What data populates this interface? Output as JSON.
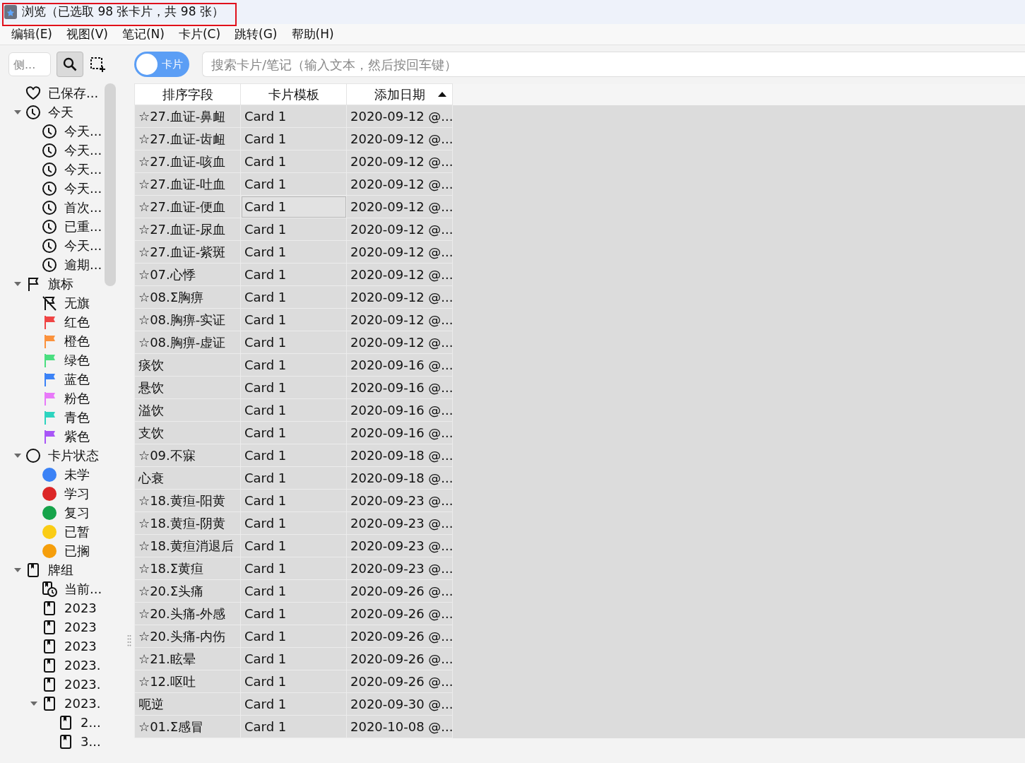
{
  "window": {
    "title": "浏览（已选取 98 张卡片，共 98 张）",
    "highlighted": true
  },
  "menu": [
    "编辑(E)",
    "视图(V)",
    "笔记(N)",
    "卡片(C)",
    "跳转(G)",
    "帮助(H)"
  ],
  "sidebar": {
    "search": {
      "placeholder": "侧..."
    },
    "items": [
      {
        "kind": "heart",
        "label": "已保存..."
      },
      {
        "kind": "clock",
        "label": "今天",
        "expanded": true,
        "children": [
          {
            "kind": "clock",
            "label": "今天..."
          },
          {
            "kind": "clock",
            "label": "今天..."
          },
          {
            "kind": "clock",
            "label": "今天..."
          },
          {
            "kind": "clock",
            "label": "今天..."
          },
          {
            "kind": "clock",
            "label": "首次..."
          },
          {
            "kind": "clock",
            "label": "已重..."
          },
          {
            "kind": "clock",
            "label": "今天..."
          },
          {
            "kind": "clock",
            "label": "逾期..."
          }
        ]
      },
      {
        "kind": "flag",
        "label": "旗标",
        "expanded": true,
        "children": [
          {
            "kind": "flag-off",
            "label": "无旗"
          },
          {
            "kind": "flag",
            "label": "红色",
            "color": "#ef4444"
          },
          {
            "kind": "flag",
            "label": "橙色",
            "color": "#fb923c"
          },
          {
            "kind": "flag",
            "label": "绿色",
            "color": "#4ade80"
          },
          {
            "kind": "flag",
            "label": "蓝色",
            "color": "#3b82f6"
          },
          {
            "kind": "flag",
            "label": "粉色",
            "color": "#e879f9"
          },
          {
            "kind": "flag",
            "label": "青色",
            "color": "#2dd4bf"
          },
          {
            "kind": "flag",
            "label": "紫色",
            "color": "#a855f7"
          }
        ]
      },
      {
        "kind": "circle",
        "label": "卡片状态",
        "expanded": true,
        "children": [
          {
            "kind": "dot",
            "label": "未学",
            "color": "#3b82f6"
          },
          {
            "kind": "dot",
            "label": "学习",
            "color": "#dc2626"
          },
          {
            "kind": "dot",
            "label": "复习",
            "color": "#16a34a"
          },
          {
            "kind": "dot",
            "label": "已暂",
            "color": "#facc15"
          },
          {
            "kind": "dot",
            "label": "已搁",
            "color": "#f59e0b"
          }
        ]
      },
      {
        "kind": "deck",
        "label": "牌组",
        "expanded": true,
        "children": [
          {
            "kind": "deck-clock",
            "label": "当前..."
          },
          {
            "kind": "deck",
            "label": "2023"
          },
          {
            "kind": "deck",
            "label": "2023"
          },
          {
            "kind": "deck",
            "label": "2023"
          },
          {
            "kind": "deck",
            "label": "2023."
          },
          {
            "kind": "deck",
            "label": "2023."
          },
          {
            "kind": "deck",
            "label": "2023.",
            "expanded": true,
            "children": [
              {
                "kind": "deck",
                "label": "2..."
              },
              {
                "kind": "deck",
                "label": "3..."
              }
            ]
          }
        ]
      }
    ]
  },
  "toolbar": {
    "toggle": {
      "label": "卡片",
      "on": false
    },
    "search": {
      "placeholder": "搜索卡片/笔记（输入文本，然后按回车键）"
    }
  },
  "table": {
    "columns": [
      {
        "label": "排序字段",
        "sorted": false
      },
      {
        "label": "卡片模板",
        "sorted": false
      },
      {
        "label": "添加日期",
        "sorted": true
      }
    ],
    "rows": [
      {
        "cells": [
          "☆27.血证-鼻衄",
          "Card 1",
          "2020-09-12 @..."
        ],
        "focused": false
      },
      {
        "cells": [
          "☆27.血证-齿衄",
          "Card 1",
          "2020-09-12 @..."
        ],
        "focused": false
      },
      {
        "cells": [
          "☆27.血证-咳血",
          "Card 1",
          "2020-09-12 @..."
        ],
        "focused": false
      },
      {
        "cells": [
          "☆27.血证-吐血",
          "Card 1",
          "2020-09-12 @..."
        ],
        "focused": false
      },
      {
        "cells": [
          "☆27.血证-便血",
          "Card 1",
          "2020-09-12 @..."
        ],
        "focused": true
      },
      {
        "cells": [
          "☆27.血证-尿血",
          "Card 1",
          "2020-09-12 @..."
        ],
        "focused": false
      },
      {
        "cells": [
          "☆27.血证-紫斑",
          "Card 1",
          "2020-09-12 @..."
        ],
        "focused": false
      },
      {
        "cells": [
          "☆07.心悸",
          "Card 1",
          "2020-09-12 @..."
        ],
        "focused": false
      },
      {
        "cells": [
          "☆08.Σ胸痹",
          "Card 1",
          "2020-09-12 @..."
        ],
        "focused": false
      },
      {
        "cells": [
          "☆08.胸痹-实证",
          "Card 1",
          "2020-09-12 @..."
        ],
        "focused": false
      },
      {
        "cells": [
          "☆08.胸痹-虚证",
          "Card 1",
          "2020-09-12 @..."
        ],
        "focused": false
      },
      {
        "cells": [
          "痰饮",
          "Card 1",
          "2020-09-16 @..."
        ],
        "focused": false
      },
      {
        "cells": [
          "悬饮",
          "Card 1",
          "2020-09-16 @..."
        ],
        "focused": false
      },
      {
        "cells": [
          "溢饮",
          "Card 1",
          "2020-09-16 @..."
        ],
        "focused": false
      },
      {
        "cells": [
          "支饮",
          "Card 1",
          "2020-09-16 @..."
        ],
        "focused": false
      },
      {
        "cells": [
          "☆09.不寐",
          "Card 1",
          "2020-09-18 @..."
        ],
        "focused": false
      },
      {
        "cells": [
          "心衰",
          "Card 1",
          "2020-09-18 @..."
        ],
        "focused": false
      },
      {
        "cells": [
          "☆18.黄疸-阳黄",
          "Card 1",
          "2020-09-23 @..."
        ],
        "focused": false
      },
      {
        "cells": [
          "☆18.黄疸-阴黄",
          "Card 1",
          "2020-09-23 @..."
        ],
        "focused": false
      },
      {
        "cells": [
          "☆18.黄疸消退后",
          "Card 1",
          "2020-09-23 @..."
        ],
        "focused": false
      },
      {
        "cells": [
          "☆18.Σ黄疸",
          "Card 1",
          "2020-09-23 @..."
        ],
        "focused": false
      },
      {
        "cells": [
          "☆20.Σ头痛",
          "Card 1",
          "2020-09-26 @..."
        ],
        "focused": false
      },
      {
        "cells": [
          "☆20.头痛-外感",
          "Card 1",
          "2020-09-26 @..."
        ],
        "focused": false
      },
      {
        "cells": [
          "☆20.头痛-内伤",
          "Card 1",
          "2020-09-26 @..."
        ],
        "focused": false
      },
      {
        "cells": [
          "☆21.眩晕",
          "Card 1",
          "2020-09-26 @..."
        ],
        "focused": false
      },
      {
        "cells": [
          "☆12.呕吐",
          "Card 1",
          "2020-09-26 @..."
        ],
        "focused": false
      },
      {
        "cells": [
          "呃逆",
          "Card 1",
          "2020-09-30 @..."
        ],
        "focused": false
      },
      {
        "cells": [
          "☆01.Σ感冒",
          "Card 1",
          "2020-10-08 @..."
        ],
        "focused": false
      }
    ]
  }
}
